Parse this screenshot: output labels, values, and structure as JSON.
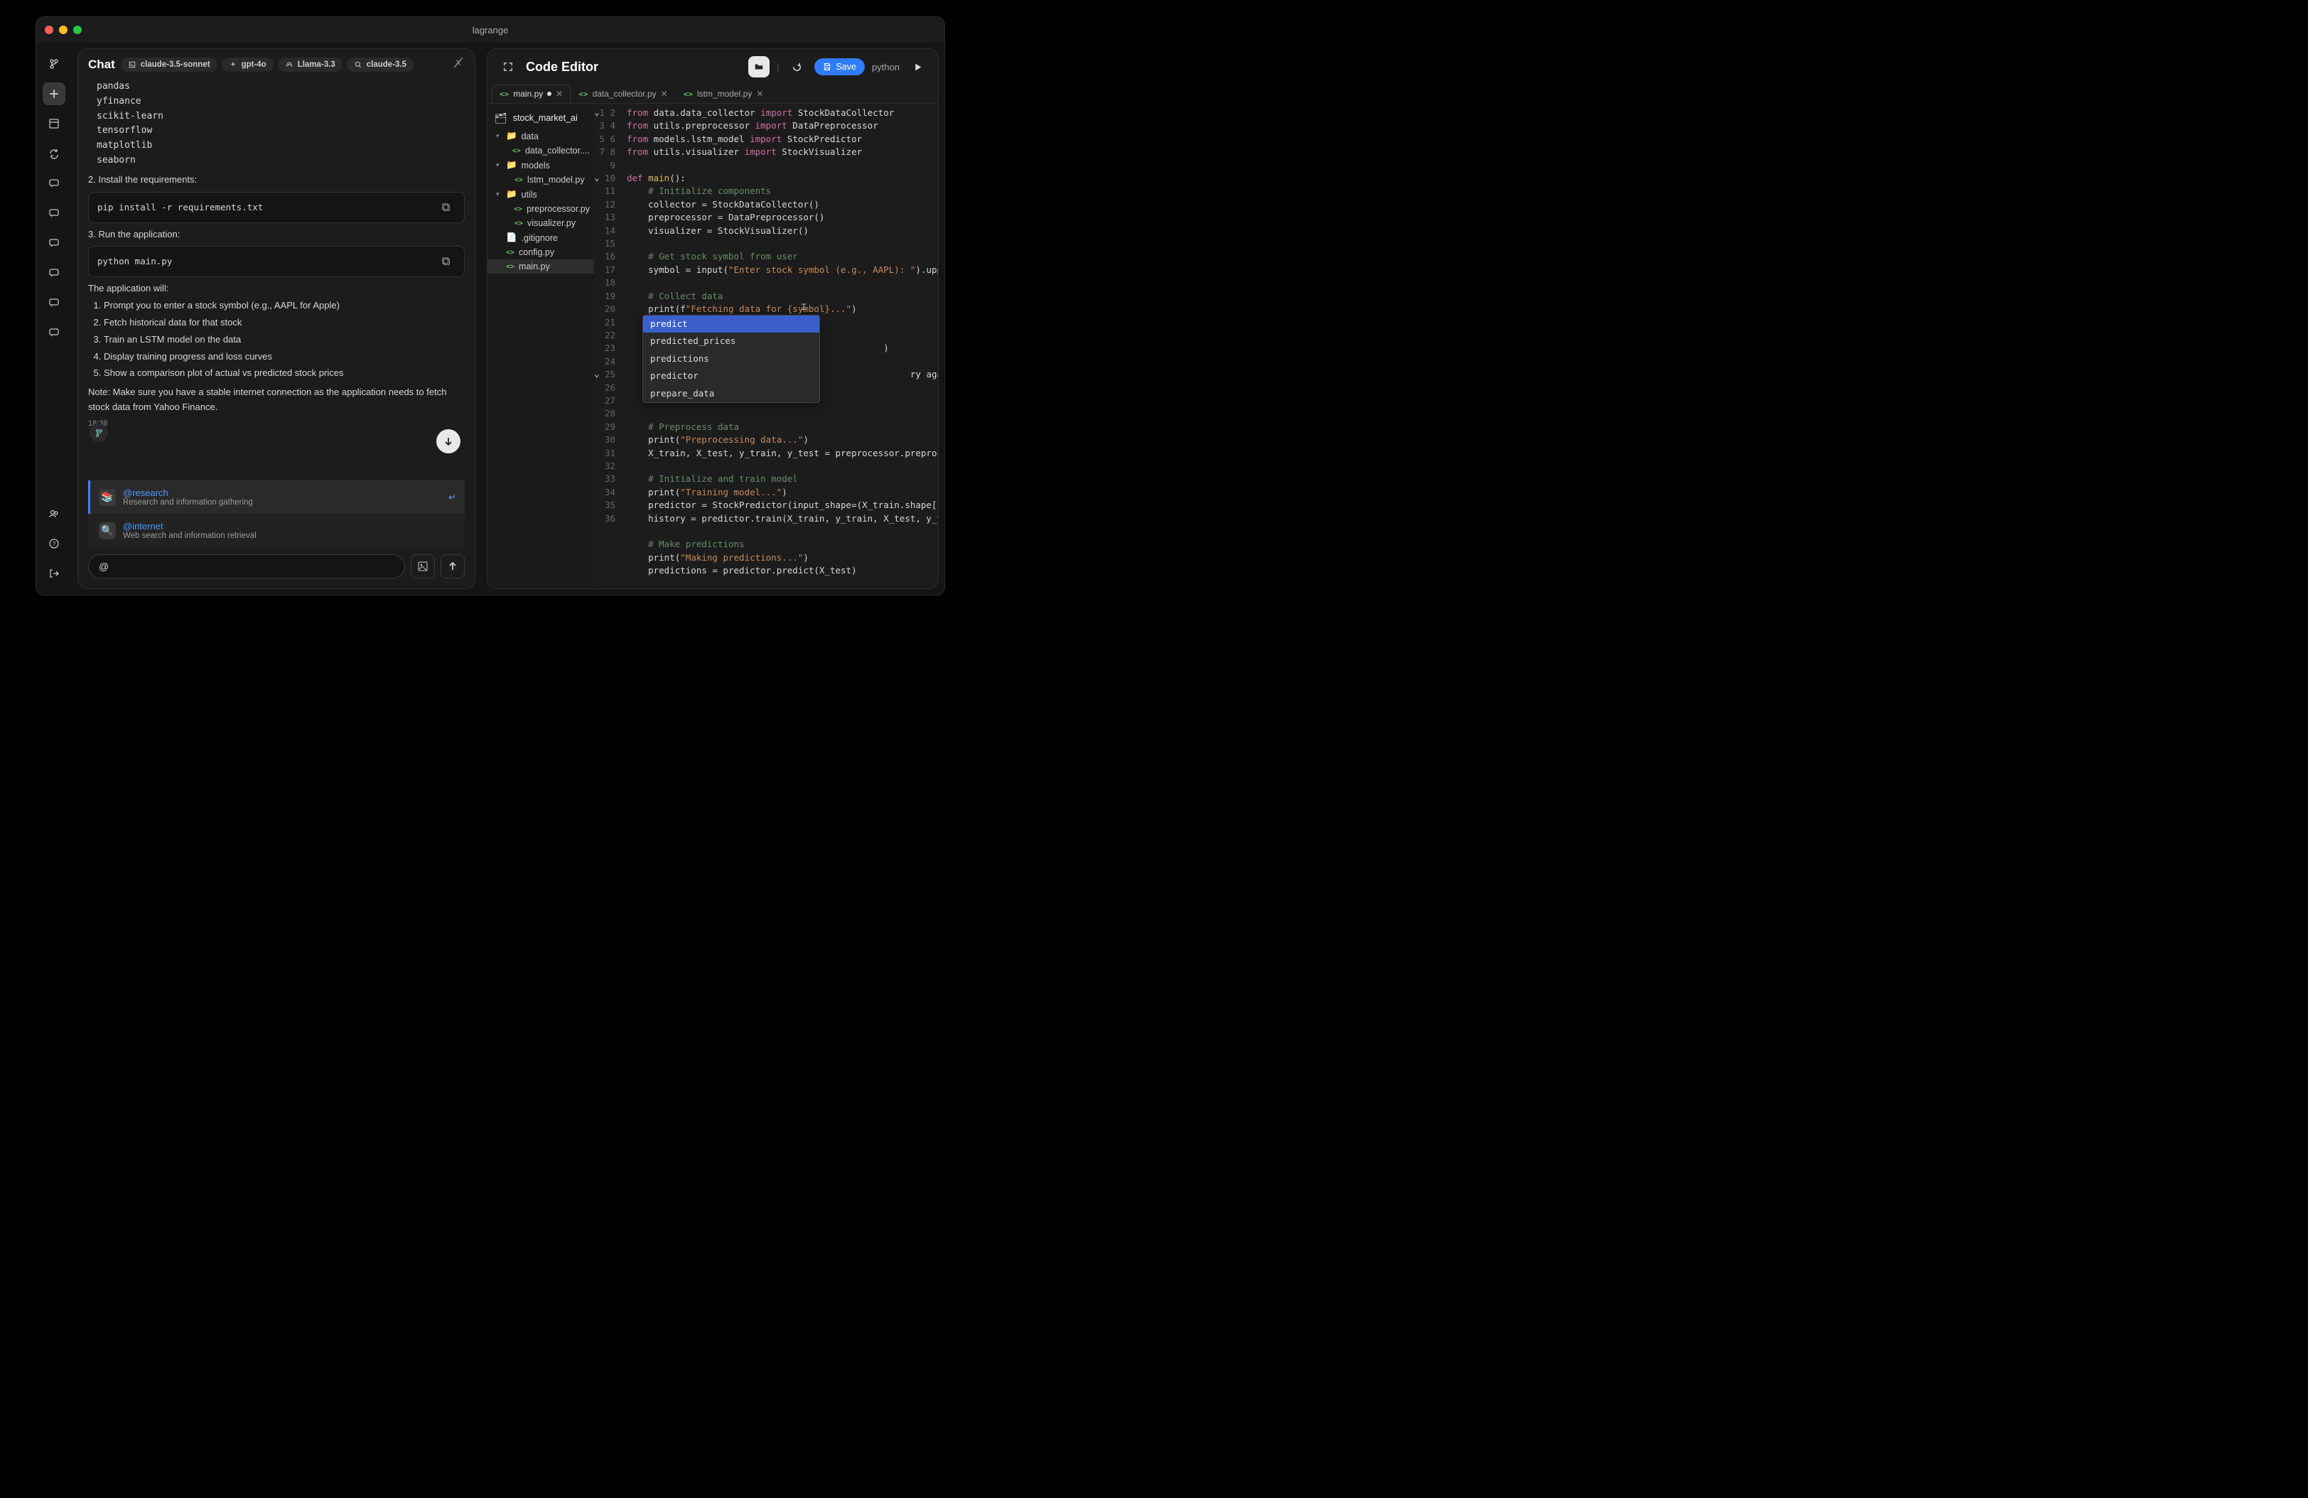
{
  "window": {
    "title": "lagrange"
  },
  "chat": {
    "title": "Chat",
    "models": [
      {
        "icon": "terminal",
        "label": "claude-3.5-sonnet"
      },
      {
        "icon": "sparkle",
        "label": "gpt-4o"
      },
      {
        "icon": "meta",
        "label": "Llama-3.3"
      },
      {
        "icon": "search",
        "label": "claude-3.5"
      }
    ],
    "reqs": [
      "pandas",
      "yfinance",
      "scikit-learn",
      "tensorflow",
      "matplotlib",
      "seaborn"
    ],
    "step2_label": "2. Install the requirements:",
    "install_cmd": "pip install -r requirements.txt",
    "step3_label": "3. Run the application:",
    "run_cmd": "python main.py",
    "app_will": "The application will:",
    "bullets": [
      "Prompt you to enter a stock symbol (e.g., AAPL for Apple)",
      "Fetch historical data for that stock",
      "Train an LSTM model on the data",
      "Display training progress and loss curves",
      "Show a comparison plot of actual vs predicted stock prices"
    ],
    "note": "Note: Make sure you have a stable internet connection as the application needs to fetch stock data from Yahoo Finance.",
    "timestamp": "18:38",
    "mentions": [
      {
        "avatar": "📚",
        "name": "@research",
        "desc": "Research and information gathering",
        "active": true
      },
      {
        "avatar": "🔍",
        "name": "@internet",
        "desc": "Web search and information retrieval",
        "active": false
      }
    ],
    "input_value": "@"
  },
  "editor": {
    "title": "Code Editor",
    "save_label": "Save",
    "language": "python",
    "tabs": [
      {
        "name": "main.py",
        "active": true,
        "modified": true
      },
      {
        "name": "data_collector.py",
        "active": false,
        "modified": false
      },
      {
        "name": "lstm_model.py",
        "active": false,
        "modified": false
      }
    ],
    "project_name": "stock_market_ai",
    "tree": [
      {
        "type": "folder",
        "name": "data",
        "depth": 0,
        "open": true
      },
      {
        "type": "file",
        "name": "data_collector....",
        "depth": 1,
        "code": true
      },
      {
        "type": "folder",
        "name": "models",
        "depth": 0,
        "open": true
      },
      {
        "type": "file",
        "name": "lstm_model.py",
        "depth": 1,
        "code": true
      },
      {
        "type": "folder",
        "name": "utils",
        "depth": 0,
        "open": true
      },
      {
        "type": "file",
        "name": "preprocessor.py",
        "depth": 1,
        "code": true
      },
      {
        "type": "file",
        "name": "visualizer.py",
        "depth": 1,
        "code": true
      },
      {
        "type": "file",
        "name": ".gitignore",
        "depth": 0,
        "code": false
      },
      {
        "type": "file",
        "name": "config.py",
        "depth": 0,
        "code": true
      },
      {
        "type": "file",
        "name": "main.py",
        "depth": 0,
        "code": true,
        "selected": true
      }
    ],
    "autocomplete": [
      "predict",
      "predicted_prices",
      "predictions",
      "predictor",
      "prepare_data"
    ],
    "code_lines": 36
  }
}
